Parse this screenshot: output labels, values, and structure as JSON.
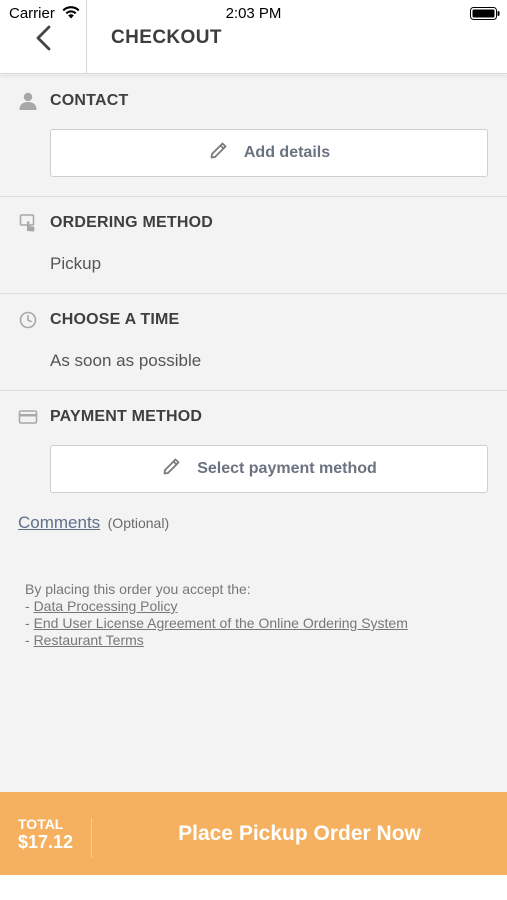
{
  "status_bar": {
    "carrier": "Carrier",
    "time": "2:03 PM"
  },
  "header": {
    "title": "CHECKOUT",
    "back_icon": "chevron-left-icon"
  },
  "sections": {
    "contact": {
      "title": "CONTACT",
      "icon": "person-icon",
      "button_label": "Add details",
      "button_icon": "pencil-icon"
    },
    "ordering_method": {
      "title": "ORDERING METHOD",
      "icon": "touch-screen-icon",
      "value": "Pickup"
    },
    "choose_time": {
      "title": "CHOOSE A TIME",
      "icon": "clock-icon",
      "value": "As soon as possible"
    },
    "payment_method": {
      "title": "PAYMENT METHOD",
      "icon": "credit-card-icon",
      "button_label": "Select payment method",
      "button_icon": "pencil-icon"
    }
  },
  "comments": {
    "link": "Comments",
    "optional": "(Optional)"
  },
  "legal": {
    "intro": "By placing this order you accept the:",
    "bullet": "- ",
    "links": [
      "Data Processing Policy",
      "End User License Agreement of the Online Ordering System",
      "Restaurant Terms"
    ]
  },
  "footer": {
    "total_label": "TOTAL",
    "total_amount": "$17.12",
    "cta": "Place Pickup Order Now"
  },
  "colors": {
    "accent": "#f5b160",
    "background": "#f3f3f3",
    "link": "#5f6f8a"
  }
}
